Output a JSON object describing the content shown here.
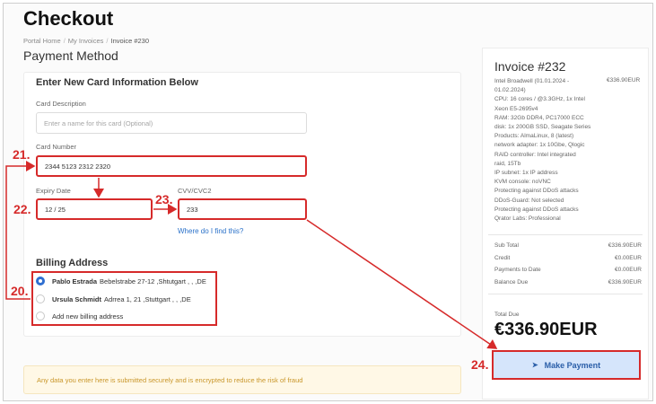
{
  "page": {
    "title": "Checkout",
    "breadcrumb": [
      "Portal Home",
      "My Invoices",
      "Invoice #230"
    ],
    "section_title": "Payment Method"
  },
  "card_form": {
    "heading": "Enter New Card Information Below",
    "description_label": "Card Description",
    "description_placeholder": "Enter a name for this card (Optional)",
    "number_label": "Card Number",
    "number_value": "2344 5123 2312 2320",
    "expiry_label": "Expiry Date",
    "expiry_value": "12 / 25",
    "cvv_label": "CVV/CVC2",
    "cvv_value": "233",
    "cvv_help": "Where do I find this?"
  },
  "billing": {
    "title": "Billing Address",
    "options": [
      {
        "name": "Pablo Estrada",
        "address": "Bebelstrabe 27-12 ,Shtutgart , , ,DE",
        "selected": true
      },
      {
        "name": "Ursula Schmidt",
        "address": "Adrrea 1, 21 ,Stuttgart , , ,DE",
        "selected": false
      },
      {
        "name": "",
        "address": "Add new billing address",
        "selected": false
      }
    ]
  },
  "notice": "Any data you enter here is submitted securely and is encrypted to reduce the risk of fraud",
  "invoice": {
    "title": "Invoice #232",
    "line_amount": "€336.90EUR",
    "description_lines": [
      "Intel Broadwell (01.01.2024 -",
      "01.02.2024)",
      "CPU: 16 cores / @3.3GHz, 1x Intel",
      "Xeon E5-2695v4",
      "RAM: 32Gb DDR4, PC17000 ECC",
      "disk: 1x 200GB SSD, Seagate Series",
      "Products: AlmaLinux, 8 (latest)",
      "network adapter: 1x 10Gbe, Qlogic",
      "RAID controller: Intel integrated",
      "raid, 15Tb",
      "IP subnet: 1x IP address",
      "KVM console: noVNC",
      "Protecting against DDoS attacks",
      "DDoS-Guard: Not selected",
      "Protecting against DDoS attacks",
      "Qrator Labs: Professional"
    ],
    "summary": [
      {
        "label": "Sub Total",
        "value": "€336.90EUR"
      },
      {
        "label": "Credit",
        "value": "€0.00EUR"
      },
      {
        "label": "Payments to Date",
        "value": "€0.00EUR"
      },
      {
        "label": "Balance Due",
        "value": "€336.90EUR"
      }
    ],
    "total_label": "Total Due",
    "total_value": "€336.90EUR",
    "pay_button": "Make Payment"
  },
  "steps": {
    "s20": "20.",
    "s21": "21.",
    "s22": "22.",
    "s23": "23.",
    "s24": "24."
  },
  "colors": {
    "annotation_red": "#d62a2a",
    "link_blue": "#2a71c9",
    "pay_button_bg": "#d5e5fb",
    "notice_bg": "#fff8e6"
  }
}
